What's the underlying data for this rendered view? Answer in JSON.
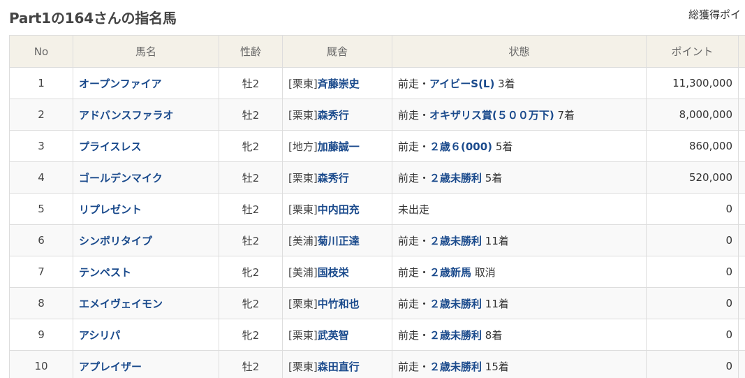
{
  "page_title": "Part1の164さんの指名馬",
  "total_label": "総獲得ポイ",
  "columns": {
    "no": "No",
    "name": "馬名",
    "sex_age": "性齢",
    "stable": "厩舎",
    "status": "状態",
    "points": "ポイント"
  },
  "rows": [
    {
      "no": "1",
      "name": "オープンファイア",
      "sex_age": "牡2",
      "region": "[栗東]",
      "trainer": "斉藤崇史",
      "status_prefix": "前走・",
      "race": "アイビーS(L)",
      "result": " 3着",
      "points": "11,300,000"
    },
    {
      "no": "2",
      "name": "アドバンスファラオ",
      "sex_age": "牡2",
      "region": "[栗東]",
      "trainer": "森秀行",
      "status_prefix": "前走・",
      "race": "オキザリス賞(５００万下)",
      "result": " 7着",
      "points": "8,000,000"
    },
    {
      "no": "3",
      "name": "プライスレス",
      "sex_age": "牝2",
      "region": "[地方]",
      "trainer": "加藤誠一",
      "status_prefix": "前走・",
      "race": "２歳６(000)",
      "result": " 5着",
      "points": "860,000"
    },
    {
      "no": "4",
      "name": "ゴールデンマイク",
      "sex_age": "牡2",
      "region": "[栗東]",
      "trainer": "森秀行",
      "status_prefix": "前走・",
      "race": "２歳未勝利",
      "result": " 5着",
      "points": "520,000"
    },
    {
      "no": "5",
      "name": "リプレゼント",
      "sex_age": "牡2",
      "region": "[栗東]",
      "trainer": "中内田充",
      "status_prefix": "未出走",
      "race": "",
      "result": "",
      "points": "0"
    },
    {
      "no": "6",
      "name": "シンボリタイプ",
      "sex_age": "牡2",
      "region": "[美浦]",
      "trainer": "菊川正達",
      "status_prefix": "前走・",
      "race": "２歳未勝利",
      "result": " 11着",
      "points": "0"
    },
    {
      "no": "7",
      "name": "テンペスト",
      "sex_age": "牝2",
      "region": "[美浦]",
      "trainer": "国枝栄",
      "status_prefix": "前走・",
      "race": "２歳新馬",
      "result": " 取消",
      "points": "0"
    },
    {
      "no": "8",
      "name": "エメイヴェイモン",
      "sex_age": "牝2",
      "region": "[栗東]",
      "trainer": "中竹和也",
      "status_prefix": "前走・",
      "race": "２歳未勝利",
      "result": " 11着",
      "points": "0"
    },
    {
      "no": "9",
      "name": "アシリパ",
      "sex_age": "牝2",
      "region": "[栗東]",
      "trainer": "武英智",
      "status_prefix": "前走・",
      "race": "２歳未勝利",
      "result": " 8着",
      "points": "0"
    },
    {
      "no": "10",
      "name": "アプレイザー",
      "sex_age": "牡2",
      "region": "[栗東]",
      "trainer": "森田直行",
      "status_prefix": "前走・",
      "race": "２歳未勝利",
      "result": " 15着",
      "points": "0"
    }
  ],
  "colors": {
    "link": "#1a4a8c",
    "header_bg": "#f4f1e8",
    "border": "#dddddd"
  }
}
